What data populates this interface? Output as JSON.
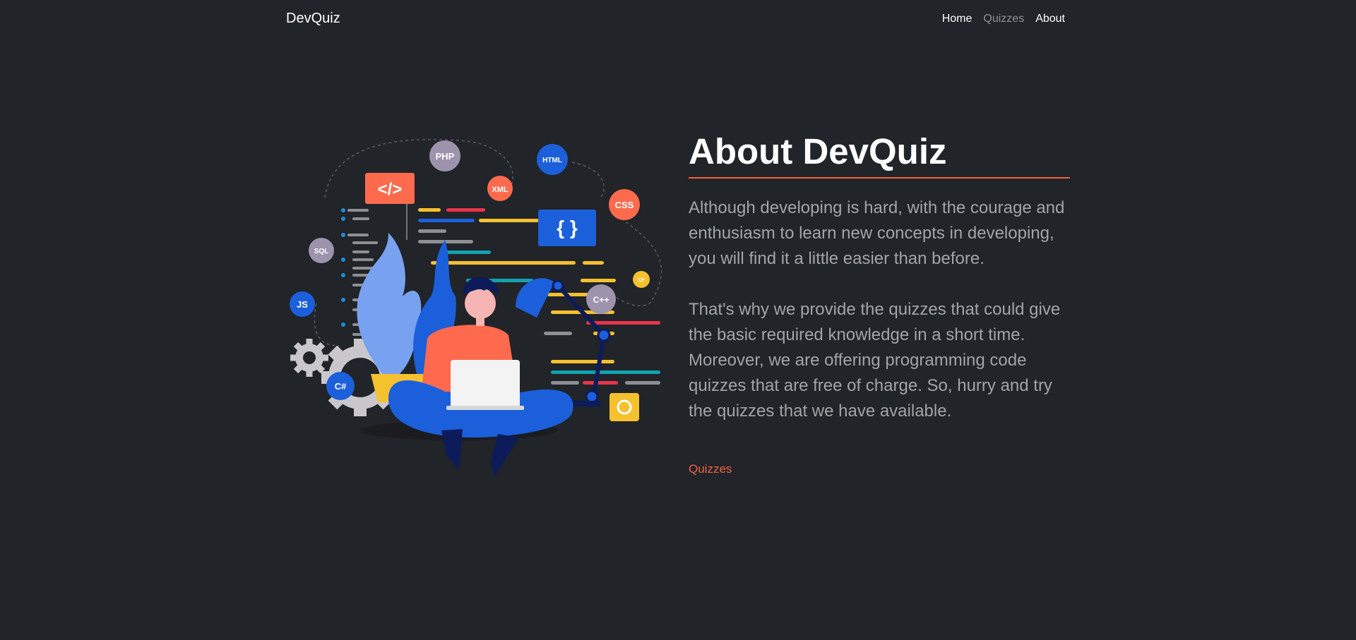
{
  "navbar": {
    "brand": "DevQuiz",
    "links": [
      {
        "label": "Home",
        "state": "active"
      },
      {
        "label": "Quizzes",
        "state": "muted"
      },
      {
        "label": "About",
        "state": "active"
      }
    ]
  },
  "illustration": {
    "badges": {
      "php": "PHP",
      "html": "HTML",
      "xml": "XML",
      "css": "CSS",
      "sql": "SQL",
      "js": "JS",
      "cpp": "C++",
      "csharp": "C#",
      "cf": "CF",
      "code": "</>",
      "braces": "{ }"
    }
  },
  "about": {
    "title": "About DevQuiz",
    "paragraph1": "Although developing is hard, with the courage and enthusiasm to learn new concepts in developing, you will find it a little easier than before.",
    "paragraph2": "That's why we provide the quizzes that could give the basic required knowledge in a short time. Moreover, we are offering programming code quizzes that are free of charge. So, hurry and try the quizzes that we have available.",
    "link": "Quizzes"
  },
  "colors": {
    "background": "#212428",
    "accent": "#f2613f",
    "text_muted": "#a2a4a7",
    "nav_muted": "#8f9296"
  }
}
